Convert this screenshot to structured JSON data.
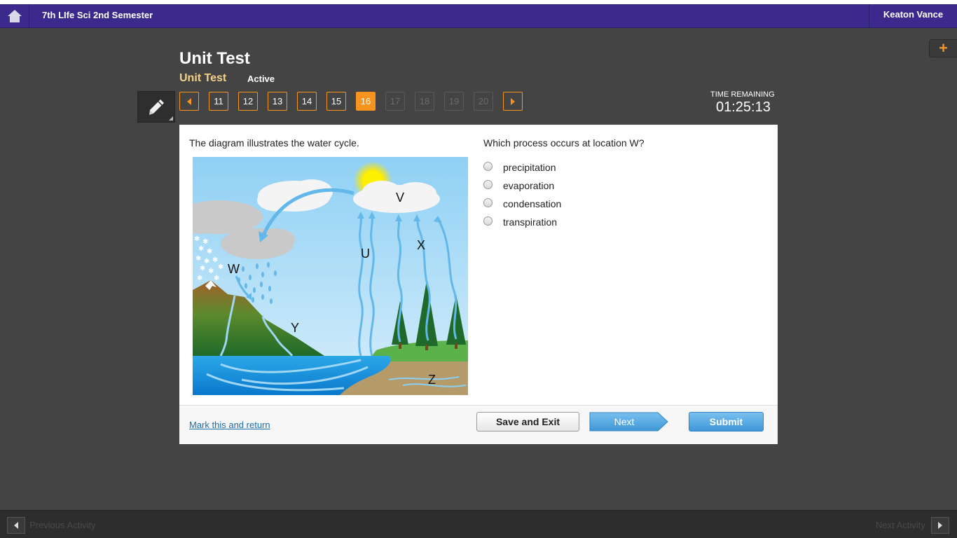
{
  "topbar": {
    "home_icon": "home-icon",
    "course_title": "7th LIfe Sci 2nd Semester",
    "user_name": "Keaton Vance"
  },
  "header": {
    "title": "Unit Test",
    "subtitle": "Unit Test",
    "status": "Active"
  },
  "tools": {
    "pencil_icon": "pencil-icon",
    "plus_icon": "plus-icon"
  },
  "question_nav": {
    "items": [
      "11",
      "12",
      "13",
      "14",
      "15",
      "16",
      "17",
      "18",
      "19",
      "20"
    ],
    "current": "16",
    "answered_range": [
      "11",
      "16"
    ]
  },
  "timer": {
    "label": "TIME REMAINING",
    "value": "01:25:13"
  },
  "question": {
    "stem_left": "The diagram illustrates the water cycle.",
    "stem_right": "Which process occurs at location W?",
    "diagram_labels": {
      "u": "U",
      "v": "V",
      "w": "W",
      "x": "X",
      "y": "Y",
      "z": "Z"
    },
    "choices": [
      "precipitation",
      "evaporation",
      "condensation",
      "transpiration"
    ]
  },
  "footer": {
    "mark_link": "Mark this and return",
    "save_exit": "Save and Exit",
    "next": "Next",
    "submit": "Submit"
  },
  "bottombar": {
    "prev_label": "Previous Activity",
    "next_label": "Next Activity"
  },
  "colors": {
    "topbar": "#3b2a8c",
    "accent": "#f7941d",
    "subtitle": "#f3d28a",
    "button_blue": "#4aa3e0",
    "background": "#444444"
  }
}
